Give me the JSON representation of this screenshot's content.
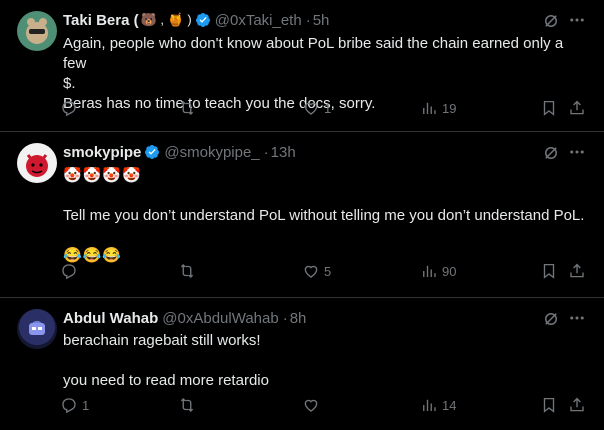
{
  "tweets": [
    {
      "name": "Taki Bera (",
      "name_emojis": "🐻 , 🍯 )",
      "handle": "@0xTaki_eth",
      "sep": "·",
      "time": "5h",
      "lines": [
        "Again, people who don't know about PoL bribe said the chain earned only a few",
        "$.",
        "Beras has no time to teach you the docs, sorry."
      ],
      "replies": "",
      "retweets": "",
      "likes": "1",
      "views": "19"
    },
    {
      "name": "smokypipe",
      "handle": "@smokypipe_",
      "sep": "·",
      "time": "13h",
      "lines": [
        "🤡🤡🤡🤡",
        "",
        "Tell me you don’t understand PoL without telling me you don’t understand PoL.",
        "",
        "😂😂😂"
      ],
      "replies": "",
      "retweets": "",
      "likes": "5",
      "views": "90"
    },
    {
      "name": "Abdul Wahab",
      "handle": "@0xAbdulWahab",
      "sep": "·",
      "time": "8h",
      "lines": [
        "berachain ragebait still works!",
        "",
        "you need to read more retardio"
      ],
      "replies": "1",
      "retweets": "",
      "likes": "",
      "views": "14"
    }
  ],
  "colors": {
    "background": "#000000",
    "text": "#e7e9ea",
    "muted": "#71767b",
    "verified": "#1d9bf0",
    "divider": "#2f3336"
  },
  "icons": [
    "verified-badge-icon",
    "grok-icon",
    "more-icon",
    "reply-icon",
    "retweet-icon",
    "like-icon",
    "views-icon",
    "bookmark-icon",
    "share-icon"
  ]
}
